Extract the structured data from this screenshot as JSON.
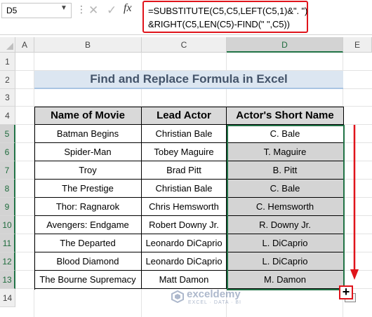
{
  "formula_bar": {
    "name_box": "D5",
    "cancel_symbol": "✕",
    "enter_symbol": "✓",
    "fx_label": "fx",
    "formula_line1": "=SUBSTITUTE(C5,C5,LEFT(C5,1)&\". \")",
    "formula_line2": "&RIGHT(C5,LEN(C5)-FIND(\" \",C5))"
  },
  "columns": [
    "A",
    "B",
    "C",
    "D",
    "E"
  ],
  "rows": [
    "1",
    "2",
    "3",
    "4",
    "5",
    "6",
    "7",
    "8",
    "9",
    "10",
    "11",
    "12",
    "13",
    "14"
  ],
  "title": "Find and Replace Formula in Excel",
  "table": {
    "headers": [
      "Name of Movie",
      "Lead Actor",
      "Actor's Short Name"
    ],
    "rows": [
      [
        "Batman Begins",
        "Christian Bale",
        "C. Bale"
      ],
      [
        "Spider-Man",
        "Tobey Maguire",
        "T. Maguire"
      ],
      [
        "Troy",
        "Brad Pitt",
        "B. Pitt"
      ],
      [
        "The Prestige",
        "Christian Bale",
        "C. Bale"
      ],
      [
        "Thor: Ragnarok",
        "Chris Hemsworth",
        "C. Hemsworth"
      ],
      [
        "Avengers: Endgame",
        "Robert Downy Jr.",
        "R. Downy Jr."
      ],
      [
        "The Departed",
        "Leonardo DiCaprio",
        "L. DiCaprio"
      ],
      [
        "Blood Diamond",
        "Leonardo DiCaprio",
        "L. DiCaprio"
      ],
      [
        "The Bourne Supremacy",
        "Matt Damon",
        "M. Damon"
      ]
    ]
  },
  "watermark": {
    "name": "exceldemy",
    "tagline": "EXCEL · DATA · BI"
  },
  "colors": {
    "accent_red": "#e0141b",
    "excel_green": "#217346",
    "title_fill": "#dce6f1",
    "header_fill": "#d9d9d9"
  }
}
